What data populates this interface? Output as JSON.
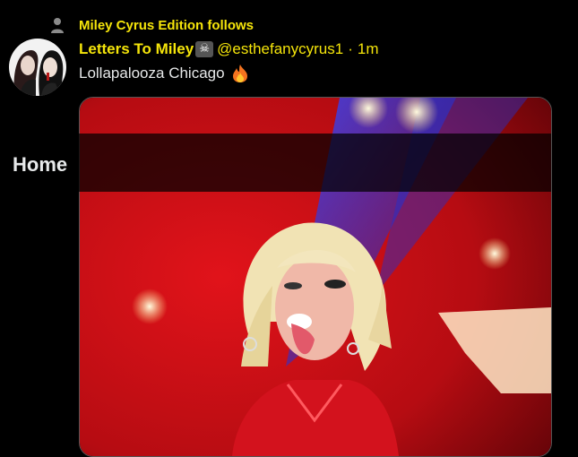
{
  "social_context": {
    "text": "Miley Cyrus Edition follows",
    "icon": "person-icon"
  },
  "tweet": {
    "author_name": "Letters To Miley",
    "author_emoji": "skull-and-crossbones-icon",
    "handle": "@esthefanycyrus1",
    "separator": "·",
    "time": "1m",
    "text": "Lollapalooza Chicago",
    "text_emoji": "fire-icon"
  },
  "header": {
    "title": "Home"
  },
  "colors": {
    "accent": "#f5e50a",
    "background": "#000000",
    "text": "#e7e9ea"
  }
}
